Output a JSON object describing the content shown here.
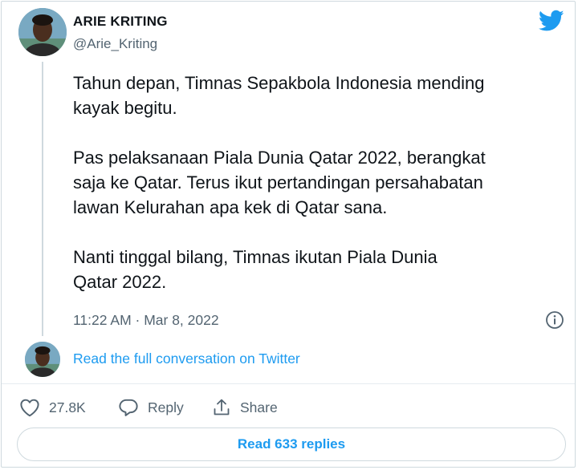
{
  "author": {
    "name": "ARIE KRITING",
    "handle": "@Arie_Kriting"
  },
  "tweet": {
    "text": "Tahun depan, Timnas Sepakbola Indonesia mending\nkayak begitu.\n\nPas pelaksanaan Piala Dunia Qatar 2022, berangkat\nsaja ke Qatar. Terus ikut pertandingan persahabatan\nlawan Kelurahan apa kek di Qatar sana.\n\nNanti tinggal bilang, Timnas ikutan Piala Dunia\nQatar 2022.",
    "timestamp": "11:22 AM · Mar 8, 2022"
  },
  "conversation_link": "Read the full conversation on Twitter",
  "actions": {
    "like_count": "27.8K",
    "reply_label": "Reply",
    "share_label": "Share"
  },
  "read_replies_label": "Read 633 replies",
  "icons": {
    "brand": "twitter-bird-icon",
    "info": "info-icon",
    "like": "heart-icon",
    "reply": "speech-bubble-icon",
    "share": "share-upload-icon"
  },
  "colors": {
    "accent": "#1d9bf0",
    "text": "#0f1419",
    "secondary": "#536471",
    "border": "#cfd9de"
  }
}
